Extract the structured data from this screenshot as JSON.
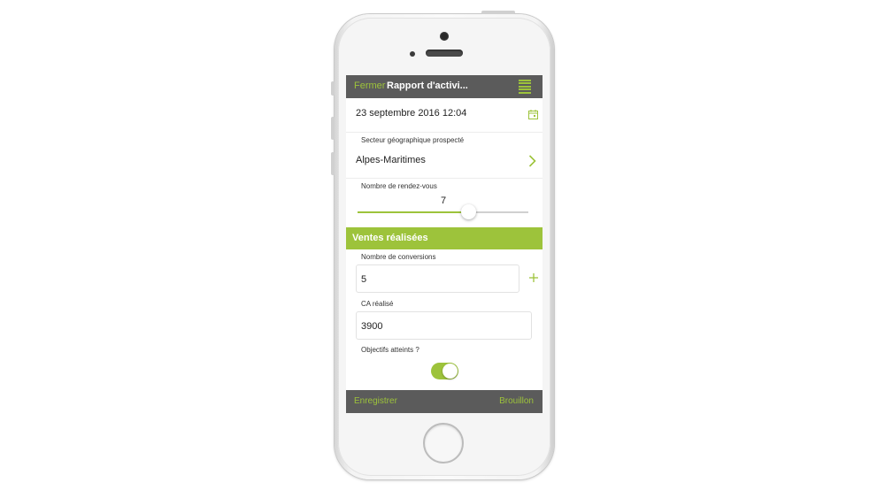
{
  "navbar": {
    "close_label": "Fermer",
    "title": "Rapport d'activi..."
  },
  "report": {
    "datetime": "23 septembre 2016 12:04",
    "sector_label": "Secteur géographique prospecté",
    "sector_value": "Alpes-Maritimes",
    "appointments_label": "Nombre de rendez-vous",
    "appointments_value": "7",
    "appointments_slider_fraction": 0.65
  },
  "sales_section": {
    "title": "Ventes réalisées",
    "conversions_label": "Nombre de conversions",
    "conversions_value": "5",
    "revenue_label": "CA réalisé",
    "revenue_value": "3900",
    "objectives_label": "Objectifs atteints ?",
    "objectives_reached": true
  },
  "bottombar": {
    "save_label": "Enregistrer",
    "draft_label": "Brouillon"
  },
  "icons": {
    "menu": "hamburger-icon",
    "calendar": "calendar-icon",
    "chevron": "chevron-right-icon",
    "plus": "plus-icon"
  },
  "colors": {
    "accent": "#9dc33b",
    "bar": "#5b5b5b"
  }
}
